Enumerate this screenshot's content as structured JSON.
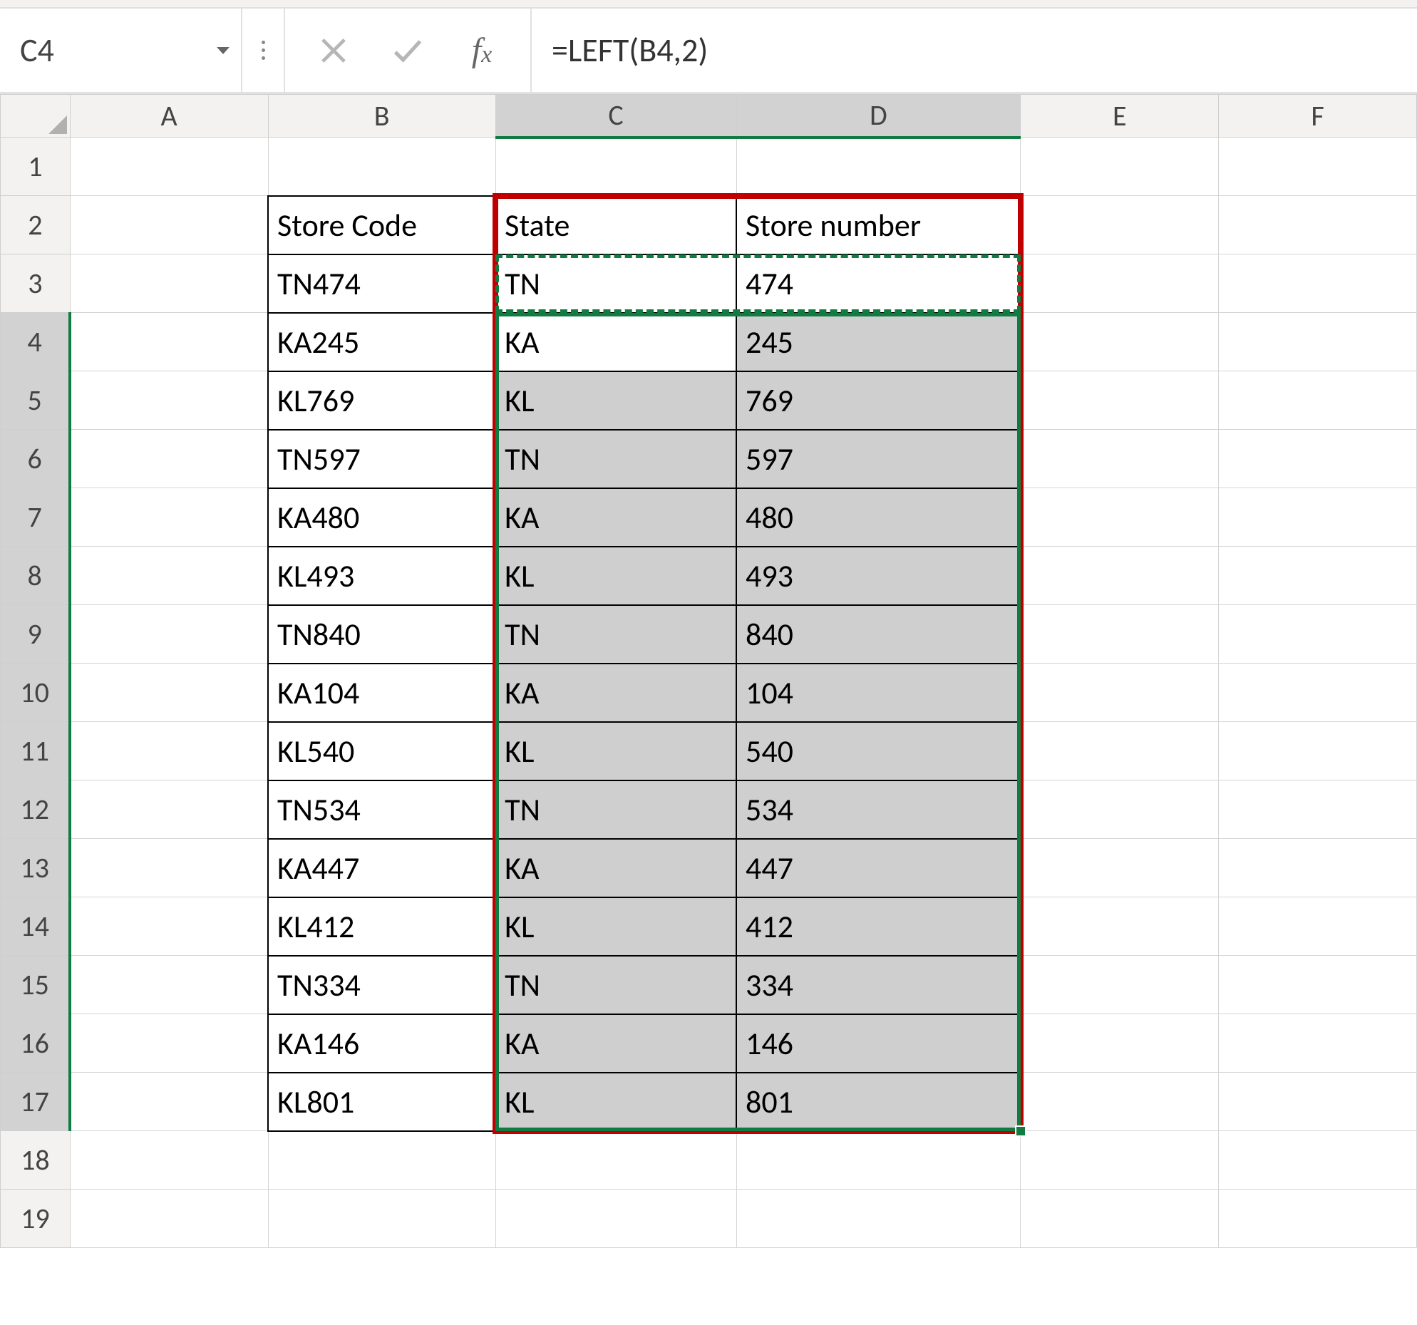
{
  "nameBox": {
    "value": "C4"
  },
  "formulaBar": {
    "value": "=LEFT(B4,2)"
  },
  "columns": [
    "A",
    "B",
    "C",
    "D",
    "E",
    "F"
  ],
  "rowCount": 19,
  "headers": {
    "b2": "Store Code",
    "c2": "State",
    "d2": "Store number"
  },
  "rows": [
    {
      "code": "TN474",
      "state": "TN",
      "num": "474"
    },
    {
      "code": "KA245",
      "state": "KA",
      "num": "245"
    },
    {
      "code": "KL769",
      "state": "KL",
      "num": "769"
    },
    {
      "code": "TN597",
      "state": "TN",
      "num": "597"
    },
    {
      "code": "KA480",
      "state": "KA",
      "num": "480"
    },
    {
      "code": "KL493",
      "state": "KL",
      "num": "493"
    },
    {
      "code": "TN840",
      "state": "TN",
      "num": "840"
    },
    {
      "code": "KA104",
      "state": "KA",
      "num": "104"
    },
    {
      "code": "KL540",
      "state": "KL",
      "num": "540"
    },
    {
      "code": "TN534",
      "state": "TN",
      "num": "534"
    },
    {
      "code": "KA447",
      "state": "KA",
      "num": "447"
    },
    {
      "code": "KL412",
      "state": "KL",
      "num": "412"
    },
    {
      "code": "TN334",
      "state": "TN",
      "num": "334"
    },
    {
      "code": "KA146",
      "state": "KA",
      "num": "146"
    },
    {
      "code": "KL801",
      "state": "KL",
      "num": "801"
    }
  ],
  "selection": {
    "activeCell": "C4",
    "copiedRange": "C3:D3",
    "pastedRange": "C4:D17",
    "highlightRange": "C2:D17"
  }
}
